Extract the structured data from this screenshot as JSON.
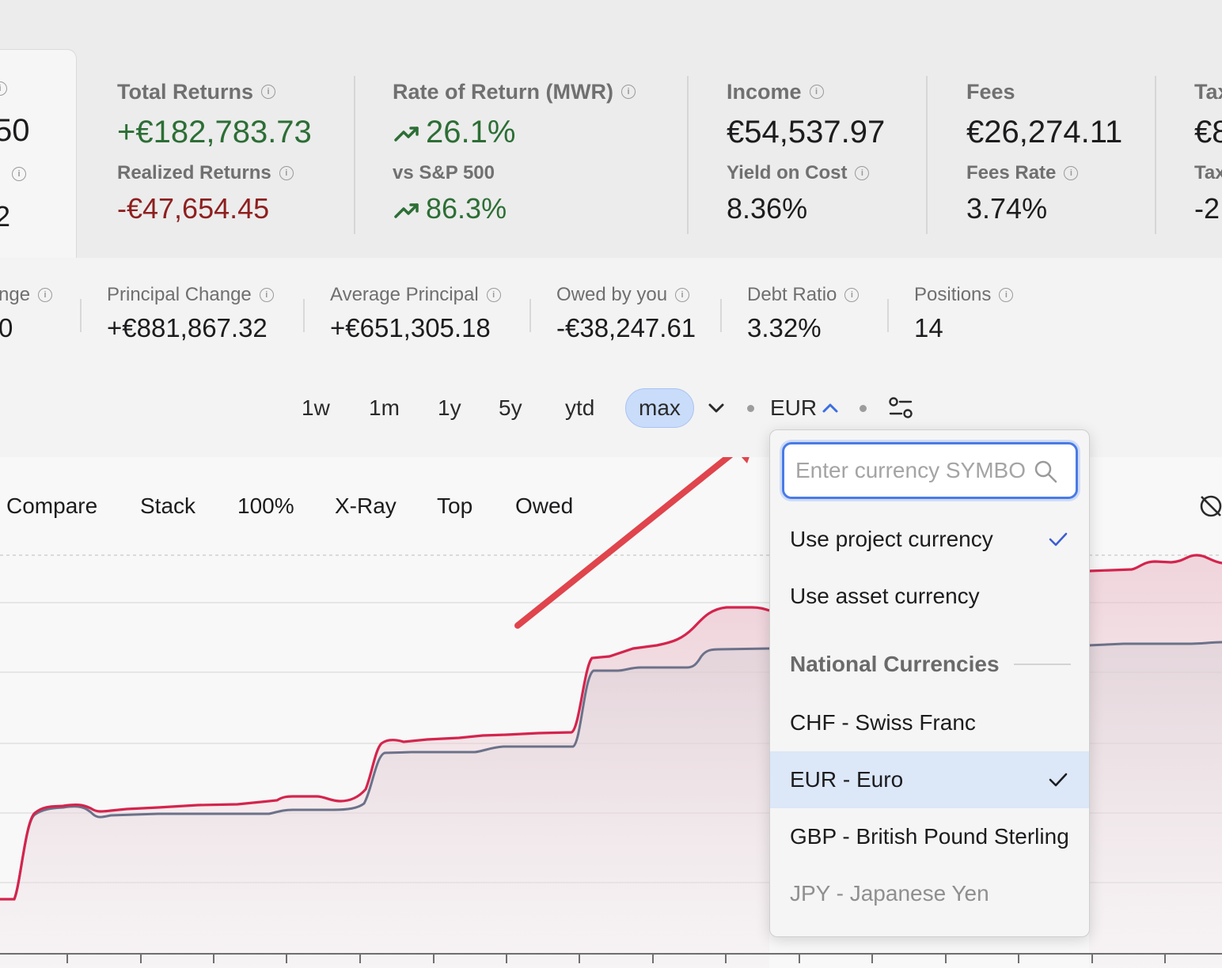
{
  "left_card": {
    "value": "50",
    "sub_label": "l",
    "sub_value": "2"
  },
  "metrics": [
    {
      "label": "Total Returns",
      "value": "+€182,783.73",
      "sub_label": "Realized Returns",
      "sub_value": "-€47,654.45"
    },
    {
      "label": "Rate of Return (MWR)",
      "value": "26.1%",
      "sub_label": "vs S&P 500",
      "sub_value": "86.3%"
    },
    {
      "label": "Income",
      "value": "€54,537.97",
      "sub_label": "Yield on Cost",
      "sub_value": "8.36%"
    },
    {
      "label": "Fees",
      "value": "€26,274.11",
      "sub_label": "Fees Rate",
      "sub_value": "3.74%"
    },
    {
      "label": "Tax",
      "value": "€8",
      "sub_label": "Tax",
      "sub_value": "-2"
    }
  ],
  "secondary_metrics": [
    {
      "label": "nge",
      "value": "0"
    },
    {
      "label": "Principal Change",
      "value": "+€881,867.32"
    },
    {
      "label": "Average Principal",
      "value": "+€651,305.18"
    },
    {
      "label": "Owed by you",
      "value": "-€38,247.61"
    },
    {
      "label": "Debt Ratio",
      "value": "3.32%"
    },
    {
      "label": "Positions",
      "value": "14"
    }
  ],
  "time_ranges": [
    "1w",
    "1m",
    "1y",
    "5y",
    "ytd",
    "max"
  ],
  "selected_range": "max",
  "currency": {
    "label": "EUR"
  },
  "chart_tabs": [
    "Compare",
    "Stack",
    "100%",
    "X-Ray",
    "Top",
    "Owed"
  ],
  "dropdown": {
    "search_placeholder": "Enter currency SYMBOL",
    "items": [
      {
        "label": "Use project currency",
        "checked": true
      },
      {
        "label": "Use asset currency",
        "checked": false
      }
    ],
    "group_label": "National Currencies",
    "currencies": [
      {
        "label": "CHF - Swiss Franc",
        "selected": false
      },
      {
        "label": "EUR - Euro",
        "selected": true
      },
      {
        "label": "GBP - British Pound Sterling",
        "selected": false
      },
      {
        "label": "JPY - Japanese Yen",
        "selected": false
      }
    ]
  },
  "colors": {
    "positive": "#2c6e35",
    "negative": "#8e1f1f",
    "accent": "#4a7be6",
    "value_line": "#d4244d",
    "principal_line": "#6b7189",
    "annotation_arrow": "#e0444c"
  },
  "icons": [
    "info-icon",
    "trend-up-icon",
    "chevron-down-icon",
    "chevron-up-icon",
    "settings-sliders-icon",
    "search-icon",
    "check-icon",
    "hide-icon"
  ],
  "chart_data": {
    "type": "area",
    "series": []
  }
}
